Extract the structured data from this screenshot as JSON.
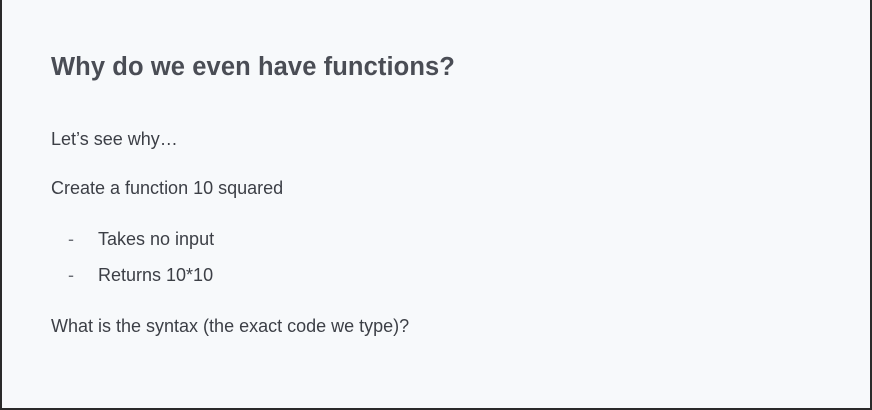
{
  "slide": {
    "title": "Why do we even have functions?",
    "intro": "Let’s see why…",
    "task": "Create a function 10 squared",
    "bullets": [
      {
        "marker": "-",
        "text": "Takes no input"
      },
      {
        "marker": "-",
        "text": "Returns 10*10"
      }
    ],
    "question": "What is the syntax (the exact code we type)?"
  }
}
